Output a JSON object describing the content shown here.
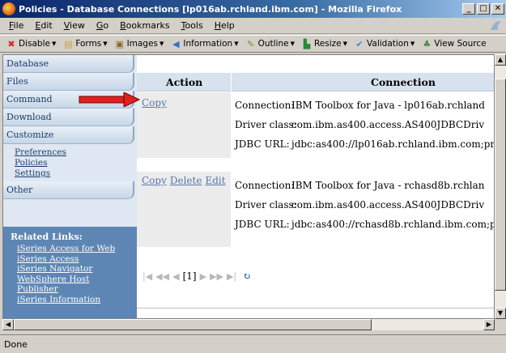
{
  "window": {
    "title": "Policies - Database Connections [lp016ab.rchland.ibm.com] - Mozilla Firefox"
  },
  "menubar": [
    "File",
    "Edit",
    "View",
    "Go",
    "Bookmarks",
    "Tools",
    "Help"
  ],
  "toolbar": [
    {
      "label": "Disable",
      "icon": "no-icon"
    },
    {
      "label": "Forms",
      "icon": "forms-icon"
    },
    {
      "label": "Images",
      "icon": "images-icon"
    },
    {
      "label": "Information",
      "icon": "info-icon"
    },
    {
      "label": "Outline",
      "icon": "pencil-icon"
    },
    {
      "label": "Resize",
      "icon": "resize-icon"
    },
    {
      "label": "Validation",
      "icon": "check-icon"
    },
    {
      "label": "View Source",
      "icon": "source-icon"
    }
  ],
  "nav": {
    "tabs": [
      "Database",
      "Files",
      "Command",
      "Download",
      "Customize",
      "Other"
    ],
    "subitems": [
      "Preferences",
      "Policies",
      "Settings"
    ],
    "related_title": "Related Links:",
    "related_links": [
      "iSeries Access for Web",
      "iSeries Access",
      "iSeries Navigator",
      "WebSphere Host",
      "Publisher",
      "iSeries Information"
    ]
  },
  "table": {
    "header_action": "Action",
    "header_connection": "Connection",
    "rows": [
      {
        "actions": [
          "Copy"
        ],
        "connection_label": "Connection:",
        "connection_value": "IBM Toolbox for Java - lp016ab.rchland",
        "driver_label": "Driver class:",
        "driver_value": "com.ibm.as400.access.AS400JDBCDriv",
        "url_label": "JDBC URL:",
        "url_value": "jdbc:as400://lp016ab.rchland.ibm.com;pr"
      },
      {
        "actions": [
          "Copy",
          "Delete",
          "Edit"
        ],
        "connection_label": "Connection:",
        "connection_value": "IBM Toolbox for Java - rchasd8b.rchlan",
        "driver_label": "Driver class:",
        "driver_value": "com.ibm.as400.access.AS400JDBCDriv",
        "url_label": "JDBC URL:",
        "url_value": "jdbc:as400://rchasd8b.rchland.ibm.com;p"
      }
    ]
  },
  "pager": {
    "page": "[1]"
  },
  "status": {
    "text": "Done"
  }
}
